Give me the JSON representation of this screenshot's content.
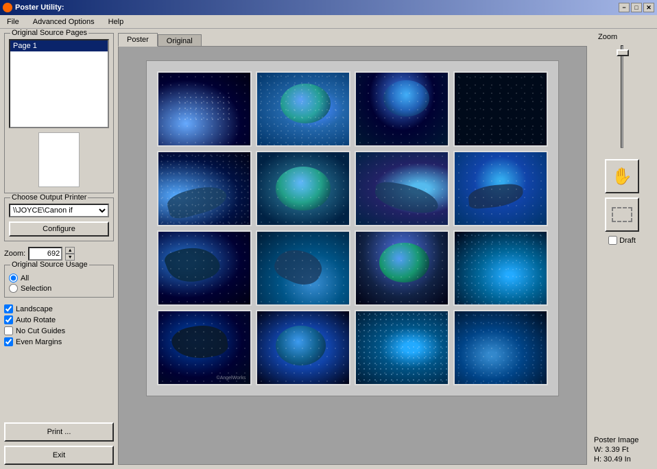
{
  "window": {
    "title": "Poster Utility:",
    "minimize": "−",
    "maximize": "□",
    "close": "✕"
  },
  "menu": {
    "file": "File",
    "advanced_options": "Advanced Options",
    "help": "Help"
  },
  "left_panel": {
    "source_group": "Original Source Pages",
    "page_item": "Page 1",
    "printer_group": "Choose Output Printer",
    "printer_value": "\\\\JOYCE\\Canon if",
    "configure_btn": "Configure",
    "zoom_label": "Zoom:",
    "zoom_value": "692",
    "source_usage_group": "Original Source Usage",
    "radio_all": "All",
    "radio_selection": "Selection",
    "cb_landscape": "Landscape",
    "cb_auto_rotate": "Auto Rotate",
    "cb_no_cut_guides": "No Cut Guides",
    "cb_even_margins": "Even Margins",
    "print_btn": "Print ...",
    "exit_btn": "Exit"
  },
  "tabs": {
    "poster": "Poster",
    "original": "Original"
  },
  "right_panel": {
    "zoom_label": "Zoom",
    "draft_label": "Draft",
    "poster_image_label": "Poster Image",
    "width_label": "W: 3.39 Ft",
    "height_label": "H: 30.49 In"
  },
  "grid": {
    "rows": 4,
    "cols": 4,
    "images": [
      {
        "id": 1,
        "type": "space-sparkles"
      },
      {
        "id": 2,
        "type": "earth-water"
      },
      {
        "id": 3,
        "type": "earth-glow"
      },
      {
        "id": 4,
        "type": "dark-space"
      },
      {
        "id": 5,
        "type": "dolphin-splash"
      },
      {
        "id": 6,
        "type": "earth-close"
      },
      {
        "id": 7,
        "type": "dolphin-swim"
      },
      {
        "id": 8,
        "type": "dolphin-dark"
      },
      {
        "id": 9,
        "type": "dolphin-jump"
      },
      {
        "id": 10,
        "type": "dolphin-under"
      },
      {
        "id": 11,
        "type": "earth-blue"
      },
      {
        "id": 12,
        "type": "sparkles-blue"
      },
      {
        "id": 13,
        "type": "dark-dolphin"
      },
      {
        "id": 14,
        "type": "underwater-blue"
      },
      {
        "id": 15,
        "type": "sparkles-light"
      },
      {
        "id": 16,
        "type": "sparkles-dark"
      }
    ]
  }
}
